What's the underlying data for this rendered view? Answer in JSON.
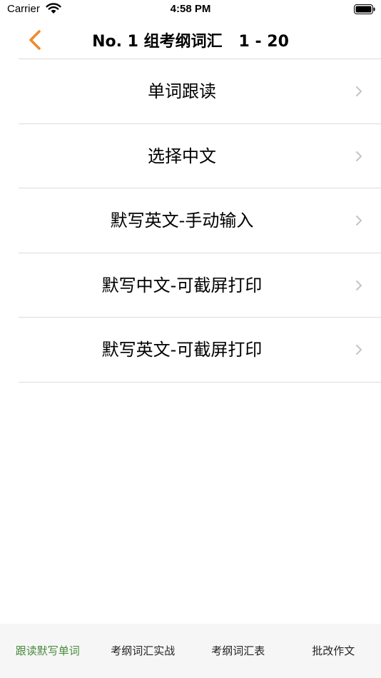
{
  "status": {
    "carrier": "Carrier",
    "time": "4:58 PM"
  },
  "nav": {
    "title": "No. 1 组考纲词汇   1 - 20"
  },
  "menu": [
    {
      "label": "单词跟读"
    },
    {
      "label": "选择中文"
    },
    {
      "label": "默写英文-手动输入"
    },
    {
      "label": "默写中文-可截屏打印"
    },
    {
      "label": "默写英文-可截屏打印"
    }
  ],
  "tabs": [
    {
      "label": "跟读默写单词",
      "active": true
    },
    {
      "label": "考纲词汇实战"
    },
    {
      "label": "考纲词汇表"
    },
    {
      "label": "批改作文"
    }
  ],
  "colors": {
    "accent": "#f0892a",
    "tab_active": "#4a8a3c",
    "chevron": "#c4c4c7",
    "divider": "#dcdcdc"
  }
}
